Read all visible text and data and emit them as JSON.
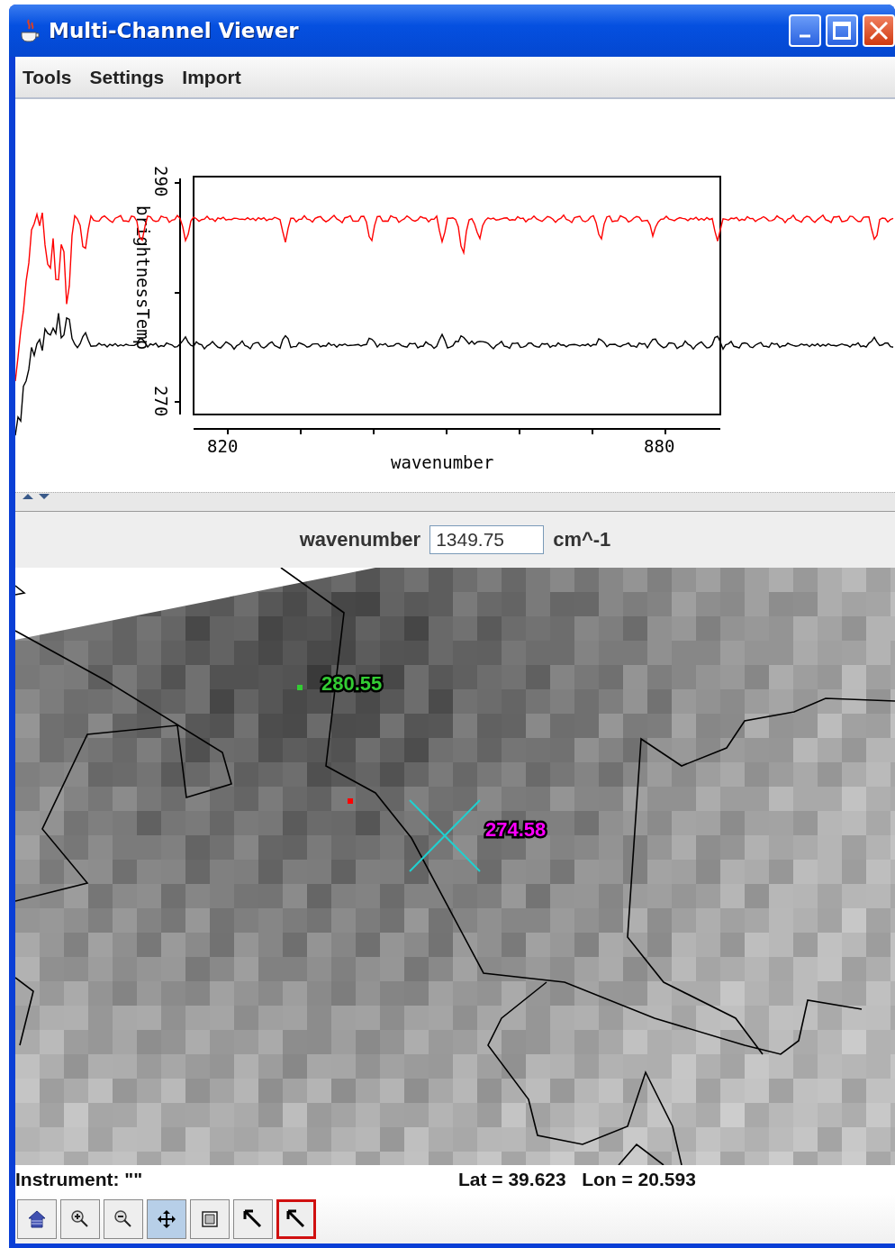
{
  "window": {
    "title": "Multi-Channel Viewer"
  },
  "menu": [
    {
      "label": "Tools"
    },
    {
      "label": "Settings"
    },
    {
      "label": "Import"
    }
  ],
  "spectrum": {
    "ylabel": "brightnessTemp",
    "xlabel": "wavenumber",
    "yticks": [
      "290",
      "270"
    ],
    "xticks": [
      "820",
      "880"
    ]
  },
  "channel": {
    "label": "wavenumber",
    "value": "1349.75",
    "unit": "cm^-1"
  },
  "map": {
    "probes": [
      {
        "kind": "dot",
        "reading": "280.55",
        "color": "#33cc33"
      },
      {
        "kind": "cross",
        "reading": "274.58",
        "color": "#ff00ff"
      }
    ]
  },
  "status": {
    "instrument": "Instrument: \"\"",
    "location": "Lat = 39.623   Lon = 20.593"
  },
  "toolbar": [
    {
      "kind": "home",
      "selected": false,
      "focused": false
    },
    {
      "kind": "zoom-in",
      "selected": false,
      "focused": false
    },
    {
      "kind": "zoom-out",
      "selected": false,
      "focused": false
    },
    {
      "kind": "move",
      "selected": true,
      "focused": false
    },
    {
      "kind": "box",
      "selected": false,
      "focused": false
    },
    {
      "kind": "pointer",
      "selected": false,
      "focused": false
    },
    {
      "kind": "pointer",
      "selected": false,
      "focused": true
    }
  ]
}
